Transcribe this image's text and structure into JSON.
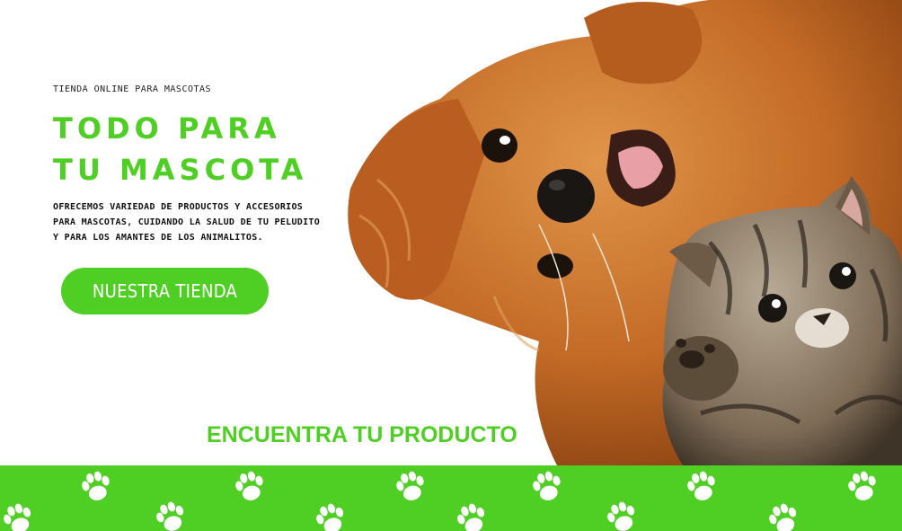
{
  "hero": {
    "eyebrow": "TIENDA ONLINE PARA MASCOTAS",
    "headline_line1": "TODO PARA",
    "headline_line2": "TU MASCOTA",
    "description": "OFRECEMOS VARIEDAD DE PRODUCTOS Y ACCESORIOS PARA MASCOTAS, CUIDANDO LA SALUD DE TU PELUDITO Y PARA LOS AMANTES DE LOS ANIMALITOS.",
    "cta_label": "NUESTRA TIENDA"
  },
  "section": {
    "title": "ENCUENTRA TU PRODUCTO"
  },
  "colors": {
    "brand_green": "#4fcf23",
    "dog_fur": "#c8702c",
    "cat_fur": "#8a7a66"
  },
  "icons": {
    "band_pattern": "paw-print-icon"
  }
}
